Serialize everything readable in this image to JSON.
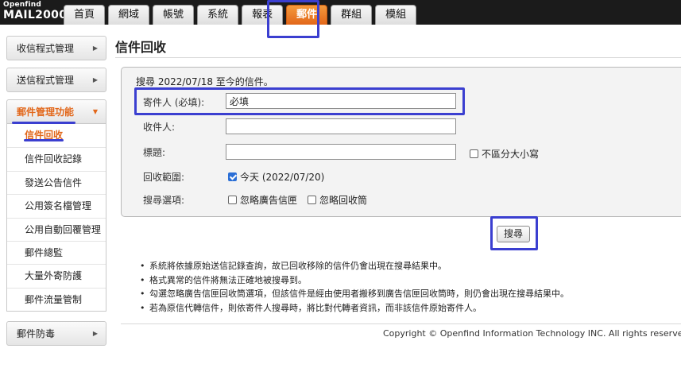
{
  "brand": {
    "line1": "Openfind",
    "line2": "MAIL2000"
  },
  "tabs": [
    {
      "label": "首頁"
    },
    {
      "label": "網域"
    },
    {
      "label": "帳號"
    },
    {
      "label": "系統"
    },
    {
      "label": "報表"
    },
    {
      "label": "郵件"
    },
    {
      "label": "群組"
    },
    {
      "label": "模組"
    }
  ],
  "active_tab": "郵件",
  "sidebar": {
    "incoming": "收信程式管理",
    "outgoing": "送信程式管理",
    "mail_mgmt": "郵件管理功能",
    "items": [
      {
        "label": "信件回收"
      },
      {
        "label": "信件回收記錄"
      },
      {
        "label": "發送公告信件"
      },
      {
        "label": "公用簽名檔管理"
      },
      {
        "label": "公用自動回覆管理"
      },
      {
        "label": "郵件總監"
      },
      {
        "label": "大量外寄防護"
      },
      {
        "label": "郵件流量管制"
      }
    ],
    "antivirus": "郵件防毒"
  },
  "page": {
    "title": "信件回收",
    "search_desc": "搜尋 2022/07/18 至今的信件。",
    "sender_label": "寄件人 (必填):",
    "sender_value": "必填",
    "recipient_label": "收件人:",
    "subject_label": "標題:",
    "case_label": "不區分大小寫",
    "range_label": "回收範圍:",
    "range_today": "今天 (2022/07/20)",
    "options_label": "搜尋選項:",
    "opt_ad": "忽略廣告信匣",
    "opt_recycle": "忽略回收筒",
    "search_button": "搜尋"
  },
  "notes": [
    "系統將依據原始送信記錄查詢，故已回收移除的信件仍會出現在搜尋結果中。",
    "格式異常的信件將無法正確地被搜尋到。",
    "勾選忽略廣告信匣回收筒選項，但該信件是經由使用者搬移到廣告信匣回收筒時，則仍會出現在搜尋結果中。",
    "若為原信代轉信件，則依寄件人搜尋時，將比對代轉者資訊，而非該信件原始寄件人。"
  ],
  "footer": {
    "copyright": "Copyright © Openfind Information Technology INC. All rights reserved."
  },
  "colors": {
    "accent": "#e2671a",
    "highlight": "#3b3fd0",
    "checkbox": "#2b6fd6"
  }
}
